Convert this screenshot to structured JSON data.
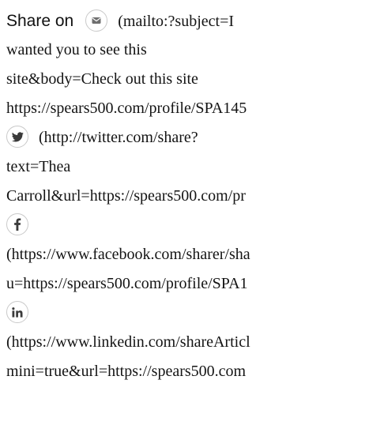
{
  "share": {
    "label": "Share on",
    "email": {
      "icon": "mail-icon",
      "lines": [
        "(mailto:?subject=I",
        "wanted you to see this",
        "site&body=Check out this site",
        "https://spears500.com/profile/SPA145"
      ]
    },
    "twitter": {
      "icon": "twitter-icon",
      "lines": [
        "(http://twitter.com/share?",
        "text=Thea",
        "Carroll&url=https://spears500.com/pr"
      ]
    },
    "facebook": {
      "icon": "facebook-icon",
      "lines": [
        "(https://www.facebook.com/sharer/sha",
        "u=https://spears500.com/profile/SPA1"
      ]
    },
    "linkedin": {
      "icon": "linkedin-icon",
      "lines": [
        "(https://www.linkedin.com/shareArticl",
        "mini=true&url=https://spears500.com"
      ]
    }
  }
}
